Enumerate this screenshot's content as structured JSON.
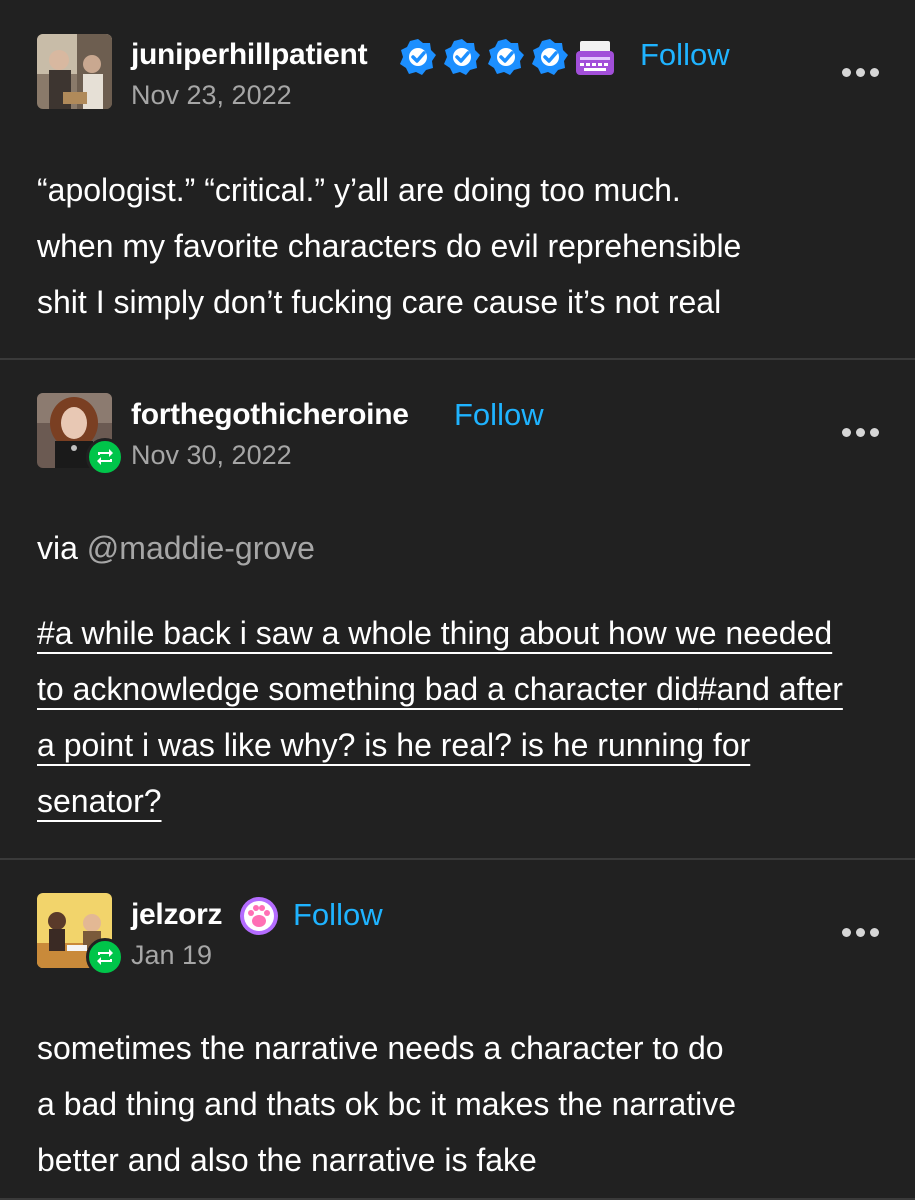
{
  "posts": [
    {
      "username": "juniperhillpatient",
      "date": "Nov 23, 2022",
      "follow_label": "Follow",
      "badges": [
        "verified-badge-icon",
        "verified-badge-icon",
        "verified-badge-icon",
        "verified-badge-icon",
        "typewriter-icon"
      ],
      "body_lines": [
        "“apologist.” “critical.” y’all are doing too much.",
        "when my favorite characters do evil reprehensible",
        "shit I simply don’t fucking care cause it’s not real"
      ]
    },
    {
      "username": "forthegothicheroine",
      "date": "Nov 30, 2022",
      "follow_label": "Follow",
      "reblog": true,
      "via_prefix": "via ",
      "via_mention": "@maddie-grove",
      "tags": [
        "#a while back i saw a whole thing about how we needed to acknowledge something bad a character did",
        "#and after a point i was like why? is he real? is he running for senator?"
      ]
    },
    {
      "username": "jelzorz",
      "date": "Jan 19",
      "follow_label": "Follow",
      "reblog": true,
      "badges": [
        "paw-badge-icon"
      ],
      "body_lines": [
        "sometimes the narrative needs a character to do",
        "a bad thing and thats ok bc it makes the narrative",
        "better and also the narrative is fake"
      ]
    }
  ],
  "colors": {
    "background": "#212121",
    "accent_follow": "#1fb3ff",
    "verified_blue": "#1c8fff",
    "reblog_green": "#00c54a",
    "muted_text": "#a6a6a6"
  }
}
